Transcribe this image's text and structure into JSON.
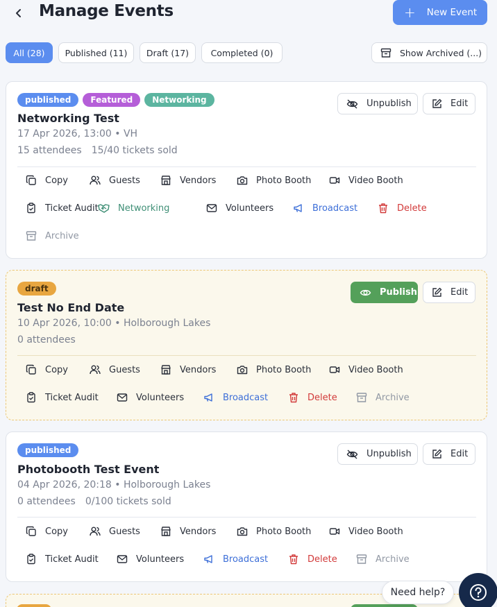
{
  "header": {
    "title": "Manage Events",
    "new_event_label": "New Event"
  },
  "filters": {
    "all": "All (28)",
    "published": "Published (11)",
    "draft": "Draft (17)",
    "completed": "Completed (0)",
    "show_archived": "Show Archived (...)"
  },
  "buttons": {
    "unpublish": "Unpublish",
    "edit": "Edit",
    "publish": "Publish"
  },
  "actions": {
    "copy": "Copy",
    "guests": "Guests",
    "vendors": "Vendors",
    "photo_booth": "Photo Booth",
    "video_booth": "Video Booth",
    "ticket_audit": "Ticket Audit",
    "networking": "Networking",
    "volunteers": "Volunteers",
    "broadcast": "Broadcast",
    "delete": "Delete",
    "archive": "Archive"
  },
  "events": [
    {
      "badges": [
        "published",
        "Featured",
        "Networking"
      ],
      "title": "Networking Test",
      "meta": "17 Apr 2026, 13:00 • VH",
      "attendees": "15 attendees",
      "tickets": "15/40 tickets sold"
    },
    {
      "badges": [
        "draft"
      ],
      "title": "Test No End Date",
      "meta": "10 Apr 2026, 10:00 • Holborough Lakes",
      "attendees": "0 attendees",
      "tickets": ""
    },
    {
      "badges": [
        "published"
      ],
      "title": "Photobooth Test Event",
      "meta": "04 Apr 2026, 20:18 • Holborough Lakes",
      "attendees": "0 attendees",
      "tickets": "0/100 tickets sold"
    }
  ],
  "help": {
    "label": "Need help?"
  },
  "colors": {
    "accent": "#5b8def",
    "published": "#5b8def",
    "featured": "#b55ed8",
    "networking": "#5cb5a0",
    "draft": "#e8a640",
    "publish_button": "#54a05a",
    "delete": "#d23a3a",
    "help_fab": "#16294a"
  }
}
